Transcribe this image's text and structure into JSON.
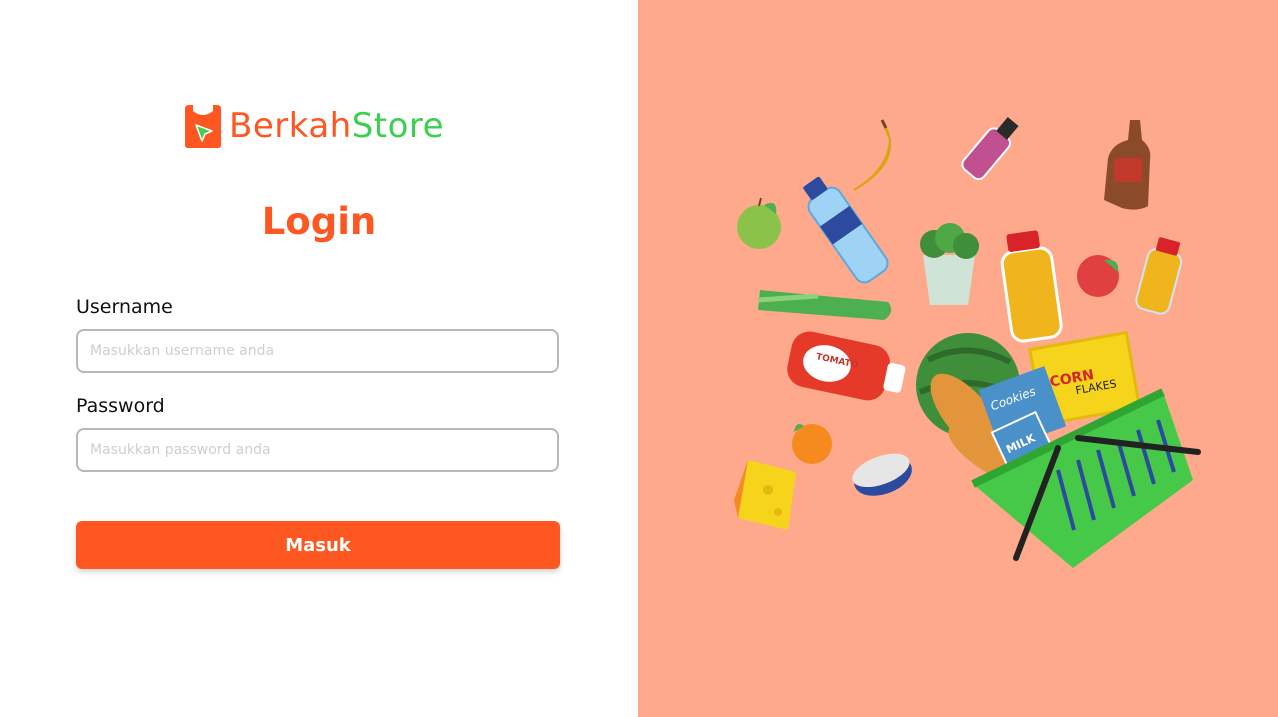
{
  "brand": {
    "name_part1": "Berkah",
    "name_part2": "Store",
    "primary_color": "#ff5722",
    "secondary_color": "#3ecf4f"
  },
  "login": {
    "title": "Login",
    "username_label": "Username",
    "username_placeholder": "Masukkan username anda",
    "password_label": "Password",
    "password_placeholder": "Masukkan password anda",
    "submit_label": "Masuk"
  },
  "illustration": {
    "background_color": "#ffa98c",
    "cookies_label": "Cookies",
    "milk_label": "MILK",
    "corn_label": "CORN",
    "flakes_label": "FLAKES",
    "tomato_label": "TOMATO"
  }
}
